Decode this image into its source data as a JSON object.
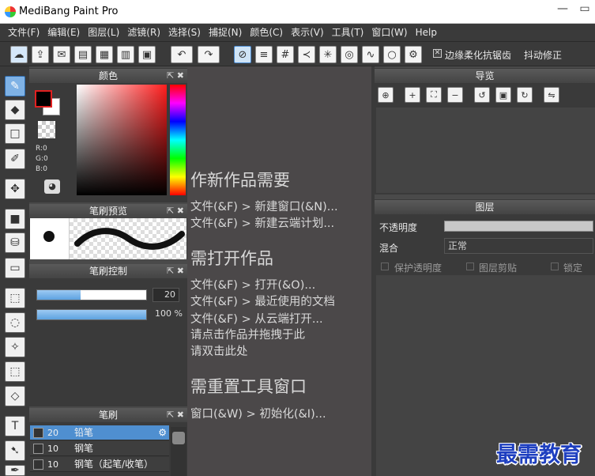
{
  "window": {
    "title": "MediBang Paint Pro",
    "minimize": "—",
    "maximize": "▭"
  },
  "menu": [
    "文件(F)",
    "编辑(E)",
    "图层(L)",
    "滤镜(R)",
    "选择(S)",
    "捕捉(N)",
    "颜色(C)",
    "表示(V)",
    "工具(T)",
    "窗口(W)",
    "Help"
  ],
  "toolbar": {
    "antialias_label": "边缘柔化抗锯齿",
    "antialias_checked": true,
    "stabilizer_label": "抖动修正"
  },
  "panels": {
    "color": {
      "title": "颜色",
      "r": "R:0",
      "g": "G:0",
      "b": "B:0",
      "foreground": "#000000",
      "background": "#ffffff"
    },
    "brush_preview": {
      "title": "笔刷预览"
    },
    "brush_control": {
      "title": "笔刷控制",
      "size": "20",
      "size_fraction": 0.4,
      "opacity": "100 %",
      "opacity_fraction": 1.0
    },
    "brush": {
      "title": "笔刷",
      "items": [
        {
          "size": "20",
          "name": "铅笔",
          "selected": true
        },
        {
          "size": "10",
          "name": "钢笔",
          "selected": false
        },
        {
          "size": "10",
          "name": "钢笔（起笔/收笔）",
          "selected": false
        }
      ]
    },
    "navigator": {
      "title": "导览"
    },
    "layer": {
      "title": "图层",
      "opacity_label": "不透明度",
      "blend_label": "混合",
      "blend_value": "正常",
      "protect_alpha": "保护透明度",
      "clipping": "图层剪贴",
      "lock": "锁定"
    }
  },
  "canvas_help": {
    "new_title": "作新作品需要",
    "new_line1": "文件(&F) > 新建窗口(&N)...",
    "new_line2": "文件(&F) > 新建云端计划...",
    "open_title": "需打开作品",
    "open_line1": "文件(&F) > 打开(&O)...",
    "open_line2": "文件(&F) > 最近使用的文档",
    "open_line3": "文件(&F) > 从云端打开...",
    "open_line4": "请点击作品并拖拽于此",
    "open_line5": "请双击此处",
    "reset_title": "需重置工具窗口",
    "reset_line1": "窗口(&W) > 初始化(&I)..."
  },
  "watermark": "最需教育",
  "colors": {
    "accent": "#4f8fd0",
    "panel": "#3a3a3a",
    "canvas_bg": "#4b4849"
  }
}
